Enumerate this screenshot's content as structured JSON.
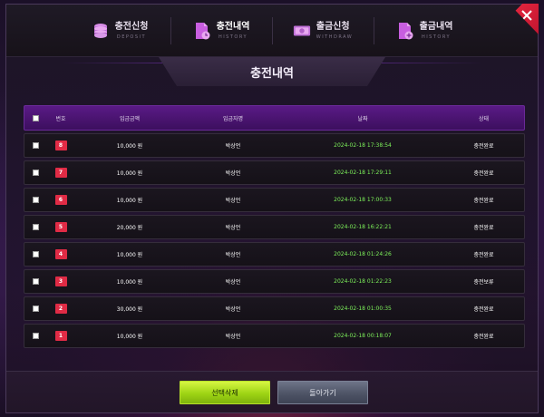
{
  "nav": {
    "items": [
      {
        "label": "충전신청",
        "sub": "DEPOSIT",
        "icon": "coin-stack-icon"
      },
      {
        "label": "충전내역",
        "sub": "HISTORY",
        "icon": "document-history-icon"
      },
      {
        "label": "출금신청",
        "sub": "WITHDRAW",
        "icon": "cash-icon"
      },
      {
        "label": "출금내역",
        "sub": "HISTORY",
        "icon": "document-add-icon"
      }
    ],
    "active_index": 1
  },
  "title": "충전내역",
  "table": {
    "headers": {
      "num": "번호",
      "amount": "입금금액",
      "name": "입금자명",
      "date": "날짜",
      "status": "상태"
    },
    "rows": [
      {
        "num": "8",
        "amount": "10,000 원",
        "name": "박상언",
        "date": "2024-02-18 17:38:54",
        "status": "충전완료"
      },
      {
        "num": "7",
        "amount": "10,000 원",
        "name": "박상언",
        "date": "2024-02-18 17:29:11",
        "status": "충전완료"
      },
      {
        "num": "6",
        "amount": "10,000 원",
        "name": "박상언",
        "date": "2024-02-18 17:00:33",
        "status": "충전완료"
      },
      {
        "num": "5",
        "amount": "20,000 원",
        "name": "박상언",
        "date": "2024-02-18 16:22:21",
        "status": "충전완료"
      },
      {
        "num": "4",
        "amount": "10,000 원",
        "name": "박상언",
        "date": "2024-02-18 01:24:26",
        "status": "충전완료"
      },
      {
        "num": "3",
        "amount": "10,000 원",
        "name": "박상언",
        "date": "2024-02-18 01:22:23",
        "status": "충전보류"
      },
      {
        "num": "2",
        "amount": "30,000 원",
        "name": "박상언",
        "date": "2024-02-18 01:00:35",
        "status": "충전완료"
      },
      {
        "num": "1",
        "amount": "10,000 원",
        "name": "박상언",
        "date": "2024-02-18 00:18:07",
        "status": "충전완료"
      }
    ]
  },
  "buttons": {
    "delete": "선택삭제",
    "back": "돌아가기"
  },
  "colors": {
    "accent": "#5a1a86",
    "badge": "#e02b45",
    "date": "#7df25a",
    "delete_btn": "#9ed414",
    "close": "#e0233c"
  }
}
